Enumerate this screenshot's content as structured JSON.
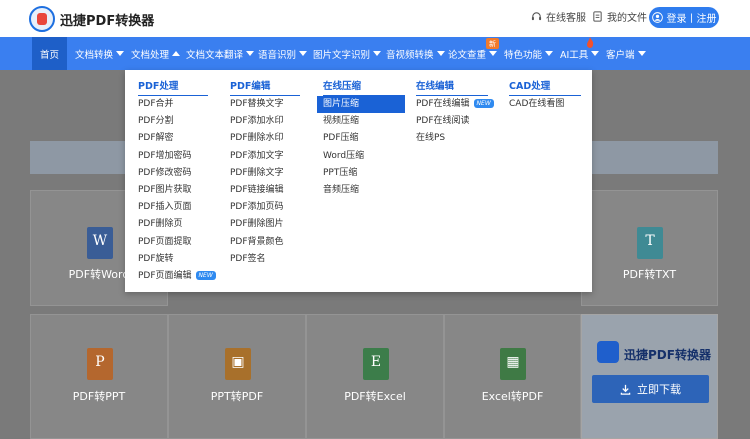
{
  "header": {
    "brand": "迅捷PDF转换器",
    "service_label": "在线客服",
    "service_icon": "headset-icon",
    "files_label": "我的文件",
    "files_icon": "file-icon",
    "login_label": "登录丨注册",
    "login_icon": "user-icon"
  },
  "nav": {
    "items": [
      {
        "label": "首页"
      },
      {
        "label": "文档转换"
      },
      {
        "label": "文档处理"
      },
      {
        "label": "文档文本翻译"
      },
      {
        "label": "语音识别"
      },
      {
        "label": "图片文字识别"
      },
      {
        "label": "音视频转换"
      },
      {
        "label": "论文查重"
      },
      {
        "label": "特色功能"
      },
      {
        "label": "AI工具"
      },
      {
        "label": "客户端"
      }
    ],
    "new_badge": "新"
  },
  "dropdown": {
    "columns": [
      {
        "title": "PDF处理",
        "items": [
          "PDF合并",
          "PDF分割",
          "PDF解密",
          "PDF增加密码",
          "PDF修改密码",
          "PDF图片获取",
          "PDF插入页面",
          "PDF删除页",
          "PDF页面提取",
          "PDF旋转",
          "PDF页面编辑"
        ],
        "new_on": 10
      },
      {
        "title": "PDF编辑",
        "items": [
          "PDF替换文字",
          "PDF添加水印",
          "PDF删除水印",
          "PDF添加文字",
          "PDF删除文字",
          "PDF链接编辑",
          "PDF添加页码",
          "PDF删除图片",
          "PDF背景颜色",
          "PDF签名"
        ]
      },
      {
        "title": "在线压缩",
        "items": [
          "图片压缩",
          "视频压缩",
          "PDF压缩",
          "Word压缩",
          "PPT压缩",
          "音频压缩"
        ],
        "active": 0
      },
      {
        "title": "在线编辑",
        "items": [
          "PDF在线编辑",
          "PDF在线阅读",
          "在线PS"
        ],
        "new_on": 0
      },
      {
        "title": "CAD处理",
        "items": [
          "CAD在线看图"
        ]
      }
    ],
    "new_tag": "NEW"
  },
  "cards_row1": [
    {
      "label": "PDF转Word",
      "icon": "word-icon",
      "glyph": "W",
      "color": "#3a5d96"
    },
    {
      "label": "PDF转TXT",
      "icon": "txt-icon",
      "glyph": "T",
      "color": "#3f8a94"
    }
  ],
  "cards_row2": [
    {
      "label": "PDF转PPT",
      "icon": "ppt-icon",
      "glyph": "P",
      "color": "#b4672e"
    },
    {
      "label": "PPT转PDF",
      "icon": "ppt-to-pdf-icon",
      "glyph": "▣",
      "color": "#a8702b"
    },
    {
      "label": "PDF转Excel",
      "icon": "excel-icon",
      "glyph": "E",
      "color": "#3c7d4a"
    },
    {
      "label": "Excel转PDF",
      "icon": "excel-to-pdf-icon",
      "glyph": "▦",
      "color": "#3f7a45"
    }
  ],
  "promo": {
    "title": "迅捷PDF转换器",
    "download_label": "立即下载",
    "download_icon": "download-icon"
  }
}
